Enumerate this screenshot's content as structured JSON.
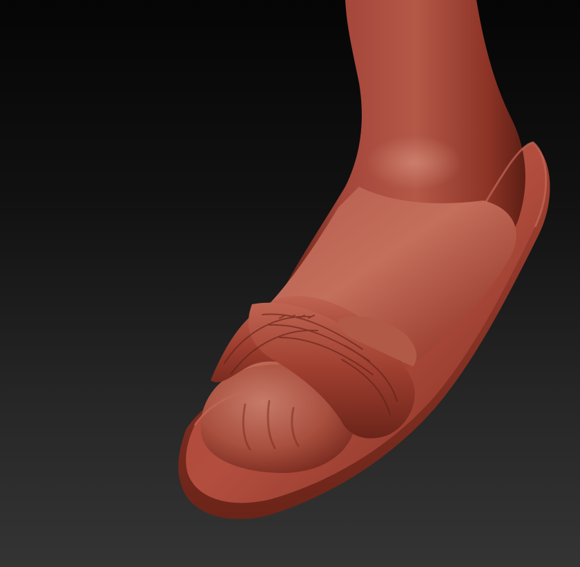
{
  "viewport": {
    "subject": "foot-in-sandal-sculpt-icon",
    "colors": {
      "background_top": "#050505",
      "background_bottom": "#343434",
      "clay_base": "#9a3a2a",
      "clay_light": "#c9806c",
      "clay_shadow": "#5a1f15",
      "clay_dark": "#3f140d"
    }
  }
}
